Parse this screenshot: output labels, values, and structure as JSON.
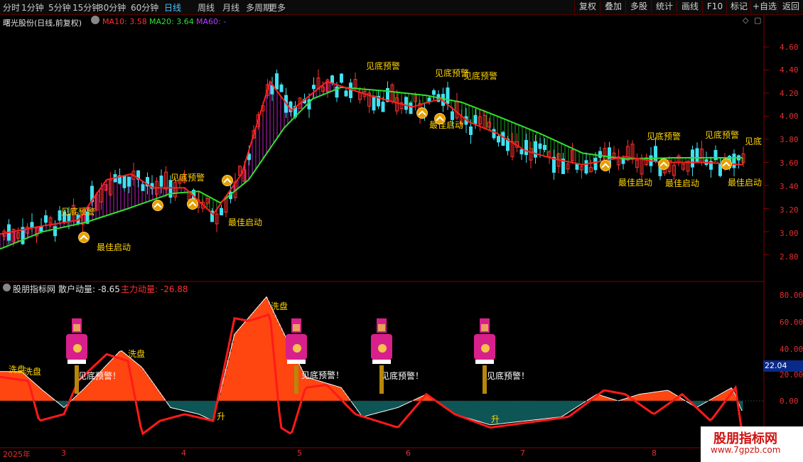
{
  "toolbar": {
    "periods": [
      "分时",
      "1分钟",
      "5分钟",
      "15分钟",
      "30分钟",
      "60分钟",
      "日线",
      "周线",
      "月线",
      "多周期",
      "更多"
    ],
    "active_period": "日线",
    "right_buttons": [
      "复权",
      "叠加",
      "多股",
      "统计",
      "画线",
      "F10",
      "标记",
      "+自选",
      "返回"
    ]
  },
  "main_chart": {
    "title": "曙光股份(日线,前复权)",
    "ma10_label": "MA10: 3.58",
    "ma20_label": "MA20: 3.64",
    "ma60_label": "MA60: -",
    "colors": {
      "ma10": "#ff2020",
      "ma20": "#30e030",
      "ma60": "#b040ff",
      "up": "#ff3030",
      "down": "#40e0f0"
    },
    "y_ticks": [
      "4.60",
      "4.40",
      "4.20",
      "4.00",
      "3.80",
      "3.60",
      "3.40",
      "3.20",
      "3.00",
      "2.80"
    ],
    "warning_label": "见底预警",
    "start_label": "最佳启动",
    "edge_label": "见底"
  },
  "indicator": {
    "name": "股朋指标网",
    "retail_label": "散户动量: -8.65",
    "main_label": "主力动量: -26.88",
    "y_ticks": [
      "80.00",
      "60.00",
      "40.00",
      "20.00",
      "0.00"
    ],
    "current_value": "22.04",
    "wash_label": "洗盘",
    "warning_text": "见底预警！",
    "rise_label": "升",
    "colors": {
      "area": "#ff4510",
      "neg_area": "#0e5555",
      "main_line": "#ff1a1a",
      "retail_line": "#ffffff"
    }
  },
  "dates": [
    "2025年",
    "3",
    "4",
    "5",
    "6",
    "7",
    "8"
  ],
  "logo": {
    "line1": "股朋指标网",
    "line2": "www.7gpzb.com"
  },
  "chart_data": {
    "type": "line",
    "title": "曙光股份(日线,前复权)",
    "ylim": [
      2.7,
      4.8
    ],
    "x": [
      "2025年",
      "3",
      "4",
      "5",
      "6",
      "7",
      "8"
    ],
    "series": [
      {
        "name": "MA10",
        "values": [
          2.9,
          3.2,
          3.0,
          4.3,
          4.1,
          3.7,
          3.62
        ]
      },
      {
        "name": "MA20",
        "values": [
          2.85,
          3.1,
          3.3,
          4.25,
          4.0,
          3.7,
          3.64
        ]
      }
    ],
    "indicator": {
      "ylim": [
        -20,
        80
      ],
      "series": [
        {
          "name": "散户动量",
          "values": [
            22,
            40,
            -5,
            78,
            10,
            -15,
            -8.65
          ]
        },
        {
          "name": "主力动量",
          "values": [
            18,
            35,
            -25,
            70,
            5,
            -15,
            -26.88
          ]
        }
      ]
    }
  }
}
